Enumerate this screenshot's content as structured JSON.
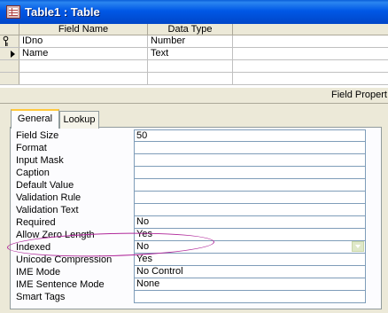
{
  "window": {
    "title": "Table1 : Table"
  },
  "grid": {
    "columns": [
      "Field Name",
      "Data Type"
    ],
    "rows": [
      {
        "field_name": "IDno",
        "data_type": "Number",
        "primary_key": true
      },
      {
        "field_name": "Name",
        "data_type": "Text",
        "current": true
      }
    ]
  },
  "field_properties": {
    "label": "Field Propert",
    "tabs": [
      "General",
      "Lookup"
    ],
    "properties": [
      {
        "label": "Field Size",
        "value": "50"
      },
      {
        "label": "Format",
        "value": ""
      },
      {
        "label": "Input Mask",
        "value": ""
      },
      {
        "label": "Caption",
        "value": ""
      },
      {
        "label": "Default Value",
        "value": ""
      },
      {
        "label": "Validation Rule",
        "value": ""
      },
      {
        "label": "Validation Text",
        "value": ""
      },
      {
        "label": "Required",
        "value": "No"
      },
      {
        "label": "Allow Zero Length",
        "value": "Yes"
      },
      {
        "label": "Indexed",
        "value": "No"
      },
      {
        "label": "Unicode Compression",
        "value": "Yes"
      },
      {
        "label": "IME Mode",
        "value": "No Control"
      },
      {
        "label": "IME Sentence Mode",
        "value": "None"
      },
      {
        "label": "Smart Tags",
        "value": ""
      }
    ]
  },
  "colors": {
    "title_bar": "#0058e6",
    "active_tab_accent": "#ffc83c",
    "annotation_ellipse": "#b0289a"
  }
}
